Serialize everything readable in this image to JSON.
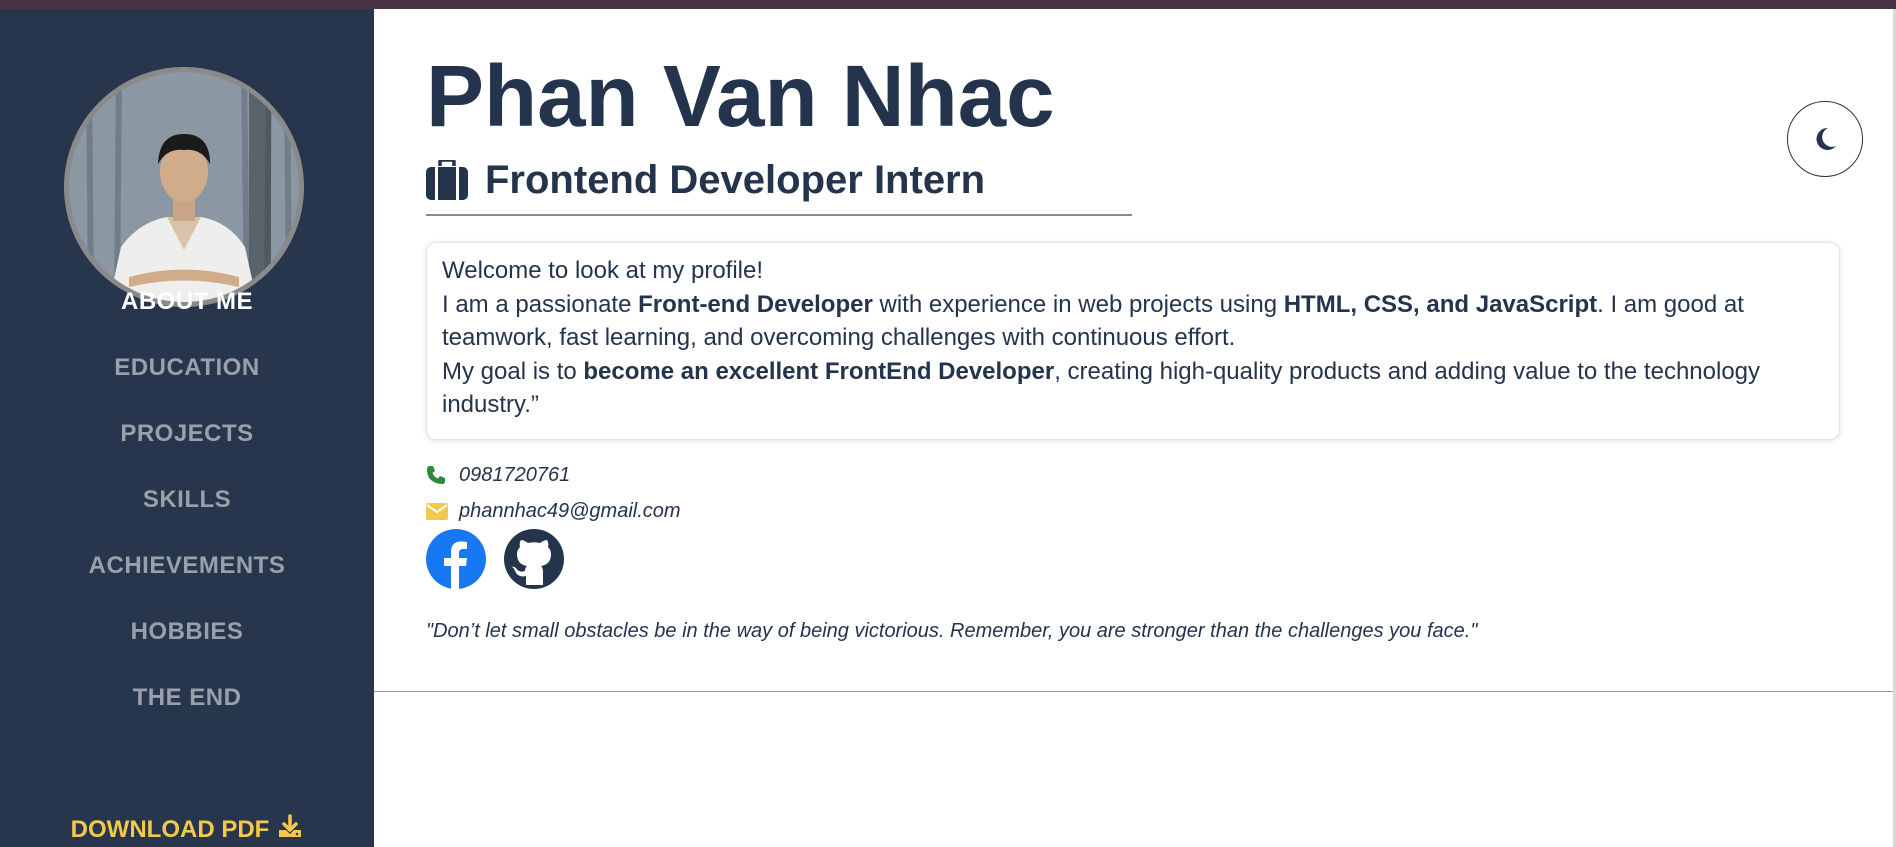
{
  "profile": {
    "name": "Phan Van Nhac",
    "role": "Frontend Developer Intern"
  },
  "sidebar": {
    "avatar_alt": "Profile photo",
    "items": [
      {
        "label": "ABOUT ME",
        "active": true
      },
      {
        "label": "EDUCATION",
        "active": false
      },
      {
        "label": "PROJECTS",
        "active": false
      },
      {
        "label": "SKILLS",
        "active": false
      },
      {
        "label": "ACHIEVEMENTS",
        "active": false
      },
      {
        "label": "HOBBIES",
        "active": false
      },
      {
        "label": "THE END",
        "active": false
      }
    ],
    "download_label": "DOWNLOAD PDF",
    "download_icon": "download-icon"
  },
  "about": {
    "line1": "Welcome to look at my profile!",
    "p2_a": "I am a passionate ",
    "p2_b": "Front-end Developer",
    "p2_c": " with experience in web projects using ",
    "p2_d": "HTML, CSS, and JavaScript",
    "p2_e": ". I am good at teamwork, fast learning, and overcoming challenges with continuous effort.",
    "p3_a": "My goal is to ",
    "p3_b": "become an excellent FrontEnd Developer",
    "p3_c": ", creating high-quality products and adding value to the technology industry.”"
  },
  "contact": {
    "phone": "0981720761",
    "phone_icon": "phone-icon",
    "email": "phannhac49@gmail.com",
    "email_icon": "envelope-icon"
  },
  "social": [
    "facebook-icon",
    "github-icon"
  ],
  "quote": "\"Don’t let small obstacles be in the way of being victorious. Remember, you are stronger than the challenges you face.\"",
  "theme_toggle_icon": "moon-icon",
  "colors": {
    "sidebar_bg": "#27364d",
    "text_primary": "#24344d",
    "nav_inactive": "#9aa0a8",
    "accent_yellow": "#f2c94c",
    "facebook_blue": "#1877f2",
    "phone_green": "#2e8b3a",
    "top_strip": "#4b3346"
  }
}
